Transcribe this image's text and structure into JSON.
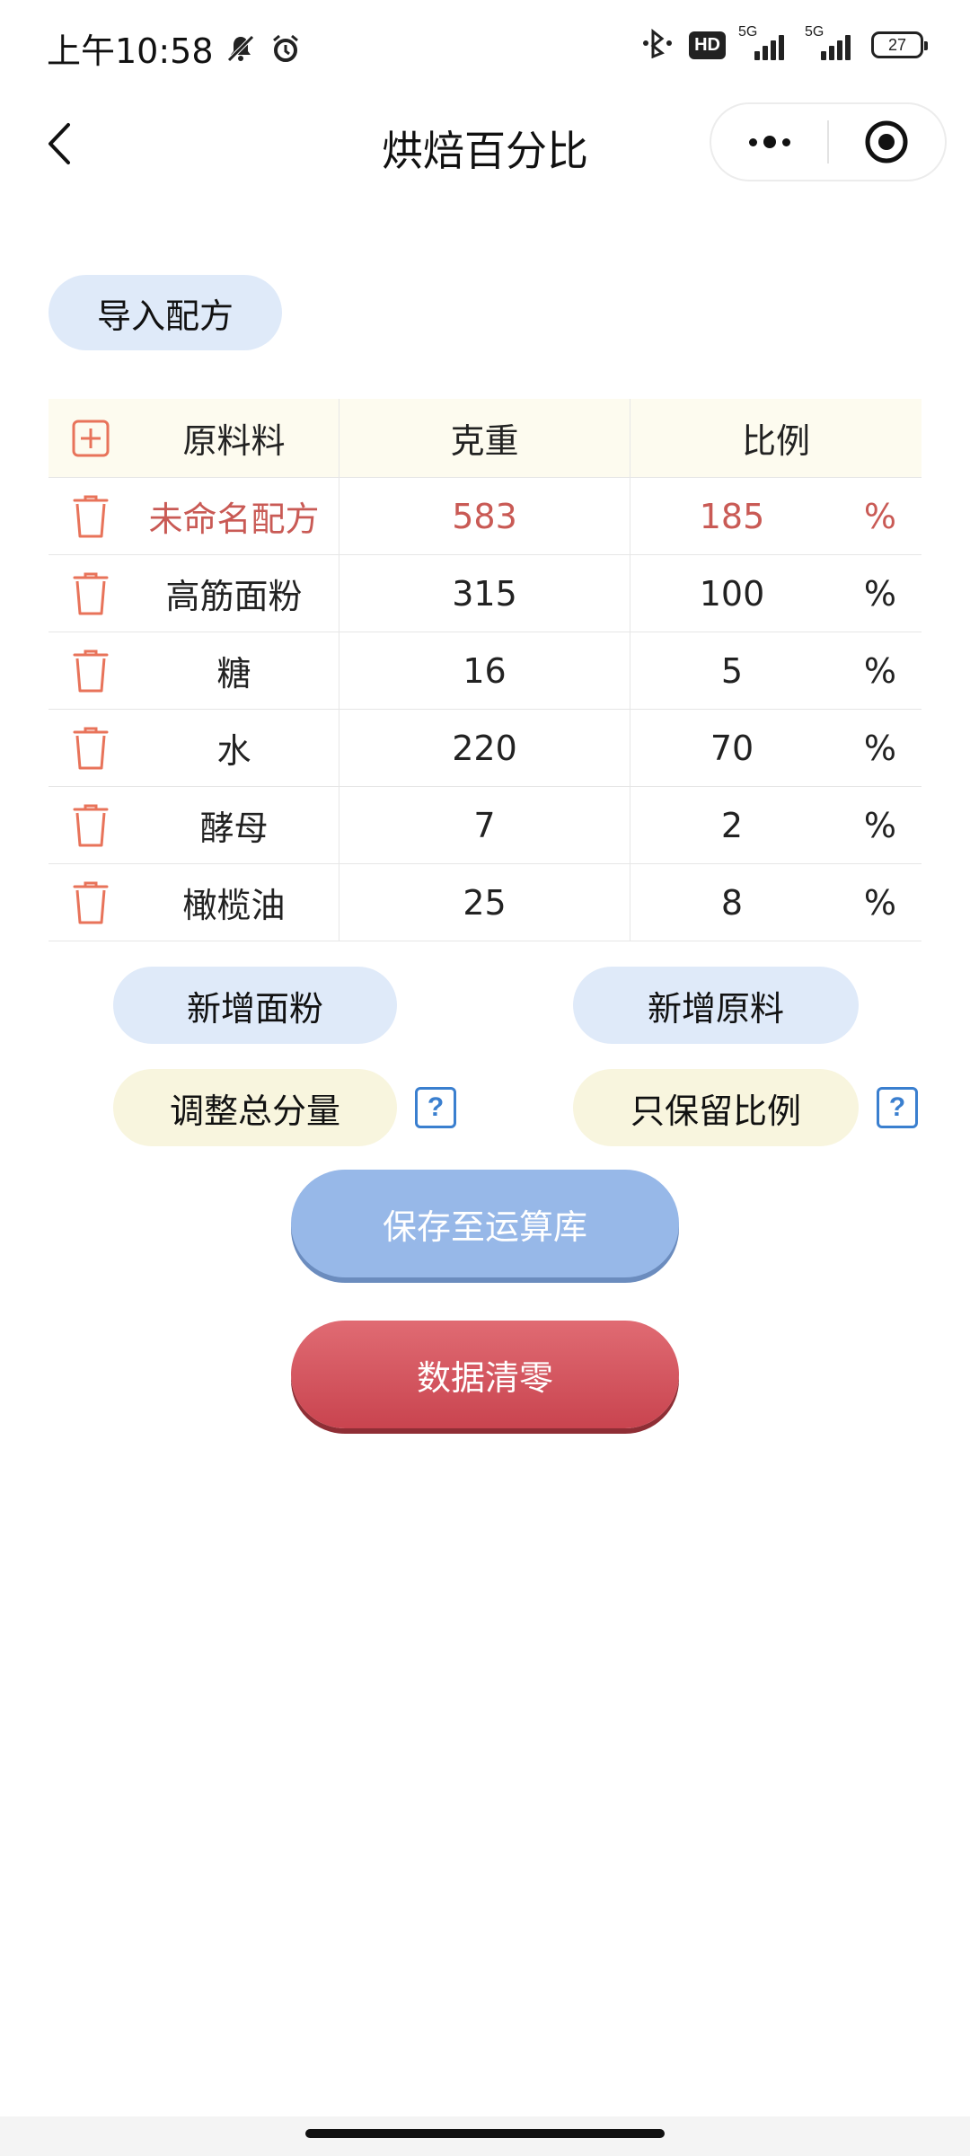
{
  "status_bar": {
    "time": "上午10:58",
    "hd_label": "HD",
    "network_label_1": "5G",
    "network_label_2": "5G",
    "battery": "27"
  },
  "nav": {
    "title": "烘焙百分比"
  },
  "actions": {
    "import_label": "导入配方",
    "add_flour_label": "新增面粉",
    "add_ingredient_label": "新增原料",
    "adjust_total_label": "调整总分量",
    "keep_ratio_label": "只保留比例",
    "help_glyph": "?",
    "save_label": "保存至运算库",
    "clear_label": "数据清零"
  },
  "table": {
    "headers": {
      "ingredient": "原料料",
      "weight": "克重",
      "ratio": "比例"
    },
    "total": {
      "name": "未命名配方",
      "weight": "583",
      "ratio": "185",
      "unit": "%"
    },
    "rows": [
      {
        "name": "高筋面粉",
        "weight": "315",
        "ratio": "100",
        "unit": "%"
      },
      {
        "name": "糖",
        "weight": "16",
        "ratio": "5",
        "unit": "%"
      },
      {
        "name": "水",
        "weight": "220",
        "ratio": "70",
        "unit": "%"
      },
      {
        "name": "酵母",
        "weight": "7",
        "ratio": "2",
        "unit": "%"
      },
      {
        "name": "橄榄油",
        "weight": "25",
        "ratio": "8",
        "unit": "%"
      }
    ]
  },
  "colors": {
    "accent_blue": "#dfeaf9",
    "accent_yellow": "#f8f5de",
    "total_red": "#c95a55",
    "icon_orange": "#e8735a"
  }
}
